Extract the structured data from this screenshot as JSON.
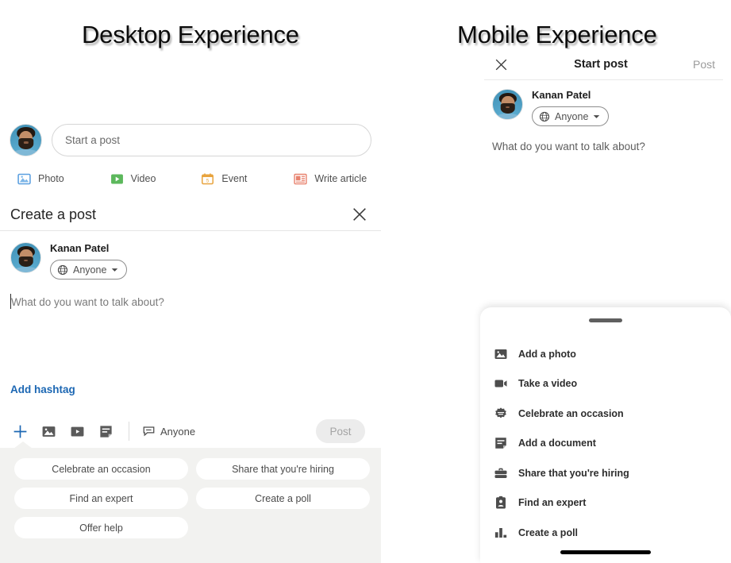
{
  "headings": {
    "desktop": "Desktop Experience",
    "mobile": "Mobile Experience"
  },
  "colors": {
    "accent_blue": "#1c67b3",
    "photo_icon": "#5a9fe0",
    "video_icon": "#5cb85c",
    "event_icon": "#e8a33d",
    "article_icon": "#e8836f",
    "toolbar_icon_gray": "#5a5a5a",
    "tray_background": "#f2f2f0",
    "post_disabled_text": "#a4a4a4"
  },
  "desktop": {
    "start_post": {
      "placeholder": "Start a post",
      "avatar_name": "user-avatar"
    },
    "quick_actions": [
      {
        "label": "Photo",
        "icon": "photo-icon"
      },
      {
        "label": "Video",
        "icon": "video-icon"
      },
      {
        "label": "Event",
        "icon": "event-icon"
      },
      {
        "label": "Write article",
        "icon": "article-icon"
      }
    ],
    "modal": {
      "title": "Create a post",
      "close_icon": "close-icon",
      "author": {
        "name": "Kanan Patel",
        "audience": "Anyone",
        "audience_icon": "globe-icon",
        "caret_icon": "chevron-down-icon"
      },
      "composer_placeholder": "What do you want to talk about?",
      "add_hashtag": "Add hashtag",
      "toolbar": {
        "plus_icon": "plus-icon",
        "icons": [
          {
            "name": "image-icon"
          },
          {
            "name": "video-play-icon"
          },
          {
            "name": "document-icon"
          }
        ],
        "audience_label": "Anyone",
        "audience_icon": "comment-bubble-icon",
        "post_label": "Post"
      },
      "suggestions": [
        "Celebrate an occasion",
        "Share that you're hiring",
        "Find an expert",
        "Create a poll",
        "Offer help"
      ]
    }
  },
  "mobile": {
    "header": {
      "close_icon": "close-icon",
      "title": "Start post",
      "post_label": "Post"
    },
    "author": {
      "name": "Kanan Patel",
      "audience": "Anyone",
      "audience_icon": "globe-icon",
      "caret_icon": "chevron-down-icon"
    },
    "composer_placeholder": "What do you want to talk about?",
    "sheet": {
      "handle": "drag-handle",
      "items": [
        {
          "label": "Add a photo",
          "icon": "photo-icon"
        },
        {
          "label": "Take a video",
          "icon": "video-camera-icon"
        },
        {
          "label": "Celebrate an occasion",
          "icon": "badge-icon"
        },
        {
          "label": "Add a document",
          "icon": "document-icon"
        },
        {
          "label": "Share that you're hiring",
          "icon": "briefcase-icon"
        },
        {
          "label": "Find an expert",
          "icon": "clipboard-person-icon"
        },
        {
          "label": "Create a poll",
          "icon": "bar-chart-icon"
        }
      ]
    }
  }
}
